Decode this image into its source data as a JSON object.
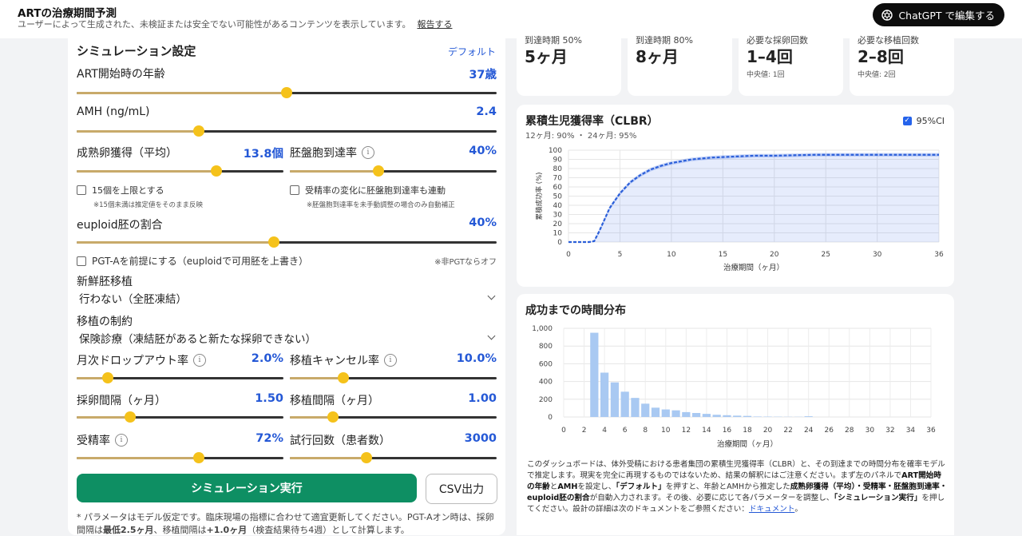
{
  "header": {
    "title": "ARTの治療期間予測",
    "subtitle": "ユーザーによって生成された、未検証または安全でない可能性があるコンテンツを表示しています。",
    "report_link": "報告する",
    "gpt_button": "ChatGPT で編集する"
  },
  "settings": {
    "title": "シミュレーション設定",
    "default_link": "デフォルト",
    "age": {
      "label": "ART開始時の年齢",
      "value": "37歳",
      "level": 0.5
    },
    "amh": {
      "label": "AMH (ng/mL)",
      "value": "2.4",
      "level": 0.29
    },
    "eggs": {
      "label": "成熟卵獲得（平均）",
      "value": "13.8個",
      "level": 0.675
    },
    "blast": {
      "label": "胚盤胞到達率",
      "value": "40%",
      "level": 0.43
    },
    "cap15": {
      "label": "15個を上限とする",
      "note": "※15個未満は推定値をそのまま反映"
    },
    "linked": {
      "label": "受精率の変化に胚盤胞到達率も連動",
      "note": "※胚盤胞到達率を未手動調整の場合のみ自動補正"
    },
    "euploid": {
      "label": "euploid胚の割合",
      "value": "40%",
      "level": 0.47
    },
    "pgta": {
      "label": "PGT-Aを前提にする（euploidで可用胚を上書き）",
      "note": "※非PGTならオフ"
    },
    "fresh": {
      "label": "新鮮胚移植",
      "value": "行わない（全胚凍結）"
    },
    "constraint": {
      "label": "移植の制約",
      "value": "保険診療（凍結胚があると新たな採卵できない）"
    },
    "dropout": {
      "label": "月次ドロップアウト率",
      "value": "2.0%",
      "level": 0.15
    },
    "cancel": {
      "label": "移植キャンセル率",
      "value": "10.0%",
      "level": 0.26
    },
    "retrieval_interval": {
      "label": "採卵間隔（ヶ月）",
      "value": "1.50",
      "level": 0.26
    },
    "transfer_interval": {
      "label": "移植間隔（ヶ月）",
      "value": "1.00",
      "level": 0.21
    },
    "fertilization": {
      "label": "受精率",
      "value": "72%",
      "level": 0.59
    },
    "trials": {
      "label": "試行回数（患者数）",
      "value": "3000",
      "level": 0.37
    },
    "run_button": "シミュレーション実行",
    "csv_button": "CSV出力",
    "footnote_1": "* パラメータはモデル仮定です。臨床現場の指標に合わせて適宜更新してください。PGT-Aオン時は、採卵間隔は",
    "footnote_bold_1": "最低2.5ヶ月",
    "footnote_2": "、移植間隔は",
    "footnote_bold_2": "+1.0ヶ月",
    "footnote_3": "（検査結果待ち4週）として計算します。"
  },
  "metrics": [
    {
      "label": "到達時期 50%",
      "value": "5ヶ月",
      "sub": ""
    },
    {
      "label": "到達時期 80%",
      "value": "8ヶ月",
      "sub": ""
    },
    {
      "label": "必要な採卵回数",
      "value": "1–4回",
      "sub": "中央値: 1回"
    },
    {
      "label": "必要な移植回数",
      "value": "2–8回",
      "sub": "中央値: 2回"
    }
  ],
  "clbr": {
    "title": "累積生児獲得率（CLBR）",
    "subtitle": "12ヶ月: 90% ・ 24ヶ月: 95%",
    "ci_label": "95%CI"
  },
  "dist": {
    "title": "成功までの時間分布"
  },
  "description": {
    "p1": "このダッシュボードは、体外受精における患者集団の累積生児獲得率（CLBR）と、その到達までの時間分布を確率モデルで推定します。現実を完全に再現するものではないため、結果の解釈にはご注意ください。まず左のパネルで",
    "b1": "ART開始時の年齢",
    "p2": "と",
    "b2": "AMH",
    "p3": "を設定し、",
    "b3": "「デフォルト」",
    "p4": "を押すと、年齢とAMHから推定した",
    "b4": "成熟卵獲得（平均）・受精率・胚盤胞到達率・euploid胚の割合",
    "p5": "が自動入力されます。その後、必要に応じて各パラメーターを調整し、",
    "b5": "「シミュレーション実行」",
    "p6": "を押してください。設計の詳細は次のドキュメントをご参照ください：",
    "link": "ドキュメント",
    "p7": "。"
  },
  "chart_data": [
    {
      "type": "line",
      "xlabel": "治療期間（ヶ月）",
      "ylabel": "累積成功率 (%)",
      "xlim": [
        0,
        36
      ],
      "ylim": [
        0,
        100
      ],
      "xticks": [
        0,
        5,
        10,
        15,
        20,
        25,
        30,
        36
      ],
      "yticks": [
        0,
        10,
        20,
        30,
        40,
        50,
        60,
        70,
        80,
        90,
        100
      ],
      "grid": true,
      "x": [
        0,
        1,
        2,
        2.5,
        3,
        4,
        5,
        6,
        7,
        8,
        9,
        10,
        11,
        12,
        14,
        16,
        18,
        20,
        24,
        28,
        32,
        36
      ],
      "series": [
        {
          "values": [
            0,
            0,
            0,
            1,
            12,
            37,
            53,
            65,
            73,
            79,
            83,
            86,
            88,
            90,
            92,
            93,
            94,
            94,
            95,
            95,
            95,
            95
          ]
        }
      ],
      "ci_lower": [
        0,
        0,
        0,
        0,
        10,
        35,
        51,
        63,
        71,
        77,
        81,
        84,
        86,
        88,
        90,
        91,
        92,
        92,
        93,
        93,
        93,
        93
      ],
      "ci_upper": [
        0,
        0,
        0,
        2,
        14,
        39,
        55,
        67,
        75,
        81,
        85,
        88,
        90,
        92,
        94,
        95,
        96,
        96,
        97,
        97,
        97,
        97
      ]
    },
    {
      "type": "bar",
      "xlabel": "治療期間（ヶ月）",
      "xlim": [
        0,
        36
      ],
      "ylim": [
        0,
        1000
      ],
      "yticks": [
        0,
        200,
        400,
        600,
        800,
        1000
      ],
      "ytick_labels": [
        "0",
        "200",
        "400",
        "600",
        "800",
        "1,000"
      ],
      "xticks": [
        0,
        2,
        4,
        6,
        8,
        10,
        12,
        14,
        16,
        18,
        20,
        22,
        24,
        26,
        28,
        30,
        32,
        34,
        36
      ],
      "categories": [
        3,
        4,
        5,
        6,
        7,
        8,
        9,
        10,
        11,
        12,
        13,
        14,
        15,
        16,
        17,
        18,
        19,
        20,
        21,
        22,
        23,
        24
      ],
      "values": [
        950,
        500,
        390,
        285,
        215,
        150,
        105,
        85,
        75,
        55,
        45,
        35,
        25,
        20,
        15,
        12,
        5,
        4,
        3,
        2,
        2,
        8
      ],
      "grid": true
    }
  ]
}
